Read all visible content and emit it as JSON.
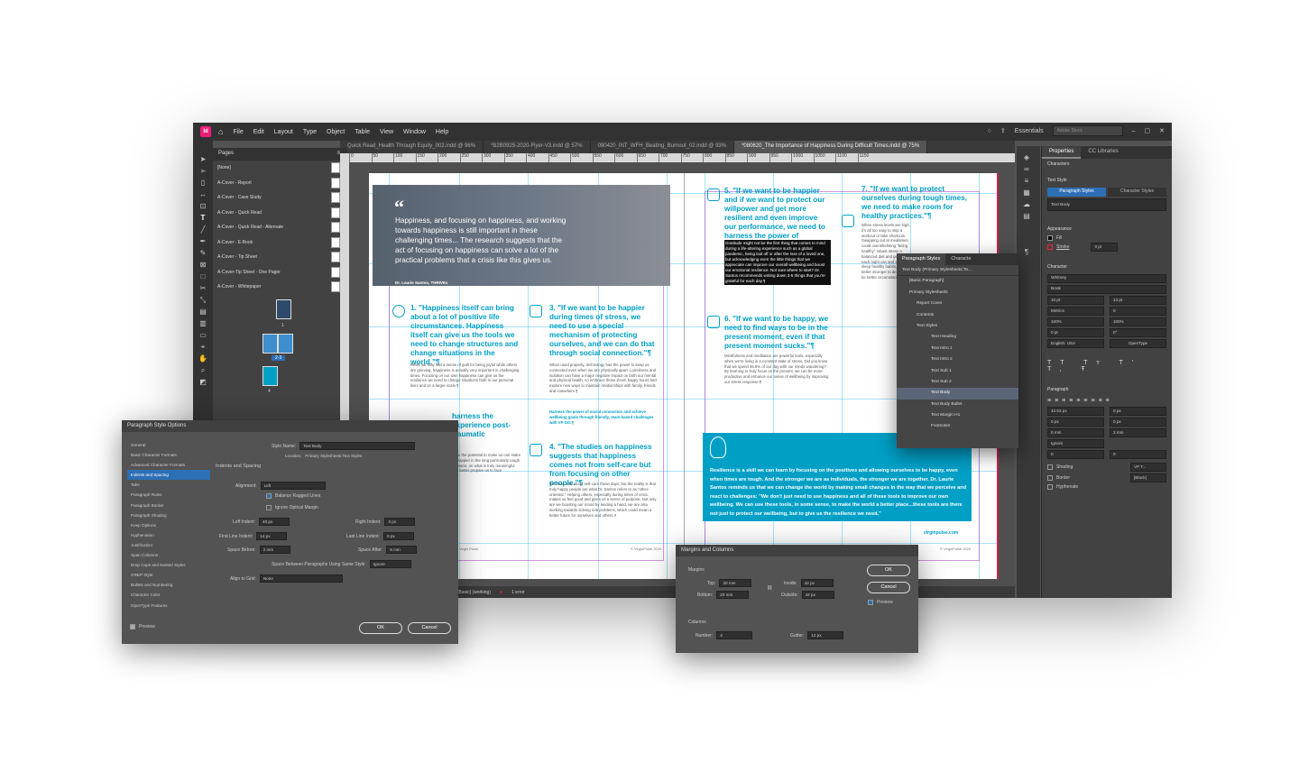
{
  "app": {
    "logo": "Id",
    "menu": [
      "File",
      "Edit",
      "Layout",
      "Type",
      "Object",
      "Table",
      "View",
      "Window",
      "Help"
    ],
    "workspace": "Essentials",
    "search_placeholder": "Adobe Stock",
    "tabs": [
      {
        "label": "Quick Read_Health Through Equity_002.indd @ 96%"
      },
      {
        "label": "*B2B0925-2020-Flyer-V3.indd @ 57%"
      },
      {
        "label": "090420_INT_WFH_Beating_Burnout_02.indd @ 93%"
      },
      {
        "label": "*080620_The Importance of Happiness During Difficult Times.indd @ 75%"
      }
    ]
  },
  "pages_panel": {
    "title": "Pages",
    "masters": [
      "[None]",
      "A-Cover - Report",
      "A-Cover - Case Study",
      "A-Cover - Quick Read",
      "A-Cover - Quick Read - Alternate",
      "A-Cover - E-Book",
      "A-Cover - Tip Sheet",
      "A-Cover-Tip Sheet - One Pager",
      "A-Cover - Whitepaper"
    ],
    "page_labels": [
      "1",
      "2-3",
      "4"
    ]
  },
  "ruler": [
    "0",
    "50",
    "100",
    "150",
    "200",
    "250",
    "300",
    "350",
    "400",
    "450",
    "500",
    "550",
    "600",
    "650",
    "700",
    "750",
    "800",
    "850",
    "900",
    "950",
    "1000",
    "1050",
    "1100",
    "1150"
  ],
  "document": {
    "hero_quote": "Happiness, and focusing on happiness, and working towards happiness is still important in these challenging times... The research suggests that the act of focusing on happiness can solve a lot of the practical problems that a crisis like this gives us.",
    "hero_credit": "Dr. Laurie Santos, THRIVEx",
    "tip1_title": "1. \"Happiness itself can bring about a lot of positive life circumstances. Happiness itself can give us the tools we need to change structures and change situations in the world.\"¶",
    "tip1_body": "While we may feel a sense of guilt for being joyful while others are grieving, happiness is actually very important in challenging times. Focusing on our own happiness can give us the resilience we need to change situations both in our personal lives and on a larger scale.¶",
    "tip2_title_partial": "harness the experience post-traumatic",
    "tip2_body_partial": "have the potential to make us can make us happier in the long particularly tough scenario, on what is truly meaningful and better prepare us to face",
    "tip3_title": "3. \"If we want to be happier during times of stress, we need to use a special mechanism of protecting ourselves, and we can do that through social connection.\"¶",
    "tip3_body": "When used properly, technology has the power to keep us connected even when we are physically apart. Loneliness and isolation can have a major negative impact on both our mental and physical health, so embrace those Zoom happy hours and explore new ways to maintain relationships with family, friends and coworkers.¶",
    "tip3_link": "Harness the power of social connection and achieve wellbeing goals through friendly, team-based challenges with VP GO.¶",
    "tip4_title": "4. \"The studies on happiness suggests that happiness comes not from self-care but from focusing on other people.\"¶",
    "tip4_body": "We hear a lot about self-care these days, but the reality is that truly happy people are what Dr. Santos refers to as \"other-oriented.\" Helping others, especially during times of crisis, makes us feel good and gives us a sense of purpose. Not only are we boosting our mood by lending a hand, we are also working towards solving real problems, which could mean a better future for ourselves and others.#",
    "tip5_title": "5. \"If we want to be happier and if we want to protect our willpower and get more resilient and even improve our performance, we need to harness the power of gratitude.\"¶",
    "tip5_selected": "Gratitude might not be the first thing that comes to mind during a life-altering experience such as a global pandemic, being laid off or after the loss of a loved one, but acknowledging even the little things that we appreciate can improve our overall wellbeing and boost our emotional resilience. Not sure where to start? Dr. Santos recommends writing down 3-5 things that you're grateful for each day.¶",
    "tip6_title": "6. \"If we want to be happy, we need to find ways to be in the present moment, even if that present moment sucks.\"¶",
    "tip6_body": "Mindfulness and meditation are powerful tools, especially when we're living in a constant state of stress. Did you know that we spend 46.9% of our day with our minds wandering? By learning to truly focus on the present, we can be more productive and enhance our sense of wellbeing by improving our stress response.¶",
    "tip7_title": "7. \"If we want to protect ourselves during tough times, we need to make room for healthy practices.\"¶",
    "tip7_body": "When stress levels are high, it's all too easy to skip a workout or take shortcuts. Swapping out at mealtimes could overwhelming \"being healthy\" robust stress a balanced diet and getting the each night can and improve sleep healthy habits, it, we are better stronger to deal and will be better circumstances",
    "resilience": "Resilience is a skill we can learn by focusing on the positives and allowing ourselves to be happy, even when times are tough. And the stronger we are as individuals, the stronger we are together. Dr. Laurie Santos reminds us that we can change the world by making small changes in the way that we perceive and react to challenges: \"We don't just need to use happiness and all of these tools to improve our own wellbeing. We can use these tools, in some sense, to make the world a better place...these tools are there not just to protect our wellbeing, but to give us the resilience we need.\"",
    "footer_url": "virginpulse.com",
    "footer_left": "Virgin Pulse",
    "footer_right": "© VirginPulse 2020"
  },
  "statusbar": {
    "style": "[Basic] (working)",
    "errors": "1 error"
  },
  "properties": {
    "tabs": [
      "Properties",
      "CC Libraries"
    ],
    "characters": "Characters",
    "text_style": "Text Style",
    "style_tabs": [
      "Paragraph Styles",
      "Character Styles"
    ],
    "current_style": "Text Body",
    "appearance": "Appearance",
    "fill": "Fill",
    "stroke": "Stroke",
    "stroke_weight": "0 pt",
    "character": "Character",
    "font": "Whitney",
    "font_style": "Book",
    "font_size": "10 pt",
    "leading": "13 pt",
    "kerning": "Metrics",
    "tracking": "0",
    "vscale": "100%",
    "hscale": "100%",
    "baseline": "0 pt",
    "skew": "0°",
    "language": "English: USA",
    "opentype": "OpenType",
    "paragraph": "Paragraph",
    "left_indent": "42.52 px",
    "right_indent": "0 px",
    "first_indent": "0 px",
    "last_indent": "0 px",
    "space_before": "0 mm",
    "space_after": "2 mm",
    "hyphenate_mode": "Ignore",
    "drop_cap_lines": "0",
    "drop_cap_chars": "0",
    "shading": "Shading",
    "shading_swatch": "VP T...",
    "border": "Border",
    "border_swatch": "[Black]",
    "hyphenate": "Hyphenate"
  },
  "paragraph_styles_panel": {
    "tabs": [
      "Paragraph Styles",
      "Characte"
    ],
    "current": "Text Body (Primary Stylesheets:Te...",
    "items": [
      {
        "label": "[Basic Paragraph]",
        "level": 0
      },
      {
        "label": "Primary Stylesheets",
        "level": 0
      },
      {
        "label": "Report Cover",
        "level": 1
      },
      {
        "label": "Contents",
        "level": 1
      },
      {
        "label": "Text Styles",
        "level": 1
      },
      {
        "label": "Text Heading",
        "level": 2
      },
      {
        "label": "Text Intro 1",
        "level": 2
      },
      {
        "label": "Text Intro 2",
        "level": 2
      },
      {
        "label": "Text Sub 1",
        "level": 2
      },
      {
        "label": "Text Sub 2",
        "level": 2
      },
      {
        "label": "Text Body",
        "level": 2,
        "selected": true
      },
      {
        "label": "Text Body Bullet",
        "level": 2
      },
      {
        "label": "Text Margin H1",
        "level": 2
      },
      {
        "label": "Footnotes",
        "level": 2
      }
    ]
  },
  "pso_dialog": {
    "title": "Paragraph Style Options",
    "categories": [
      "General",
      "Basic Character Formats",
      "Advanced Character Formats",
      "Indents and Spacing",
      "Tabs",
      "Paragraph Rules",
      "Paragraph Border",
      "Paragraph Shading",
      "Keep Options",
      "Hyphenation",
      "Justification",
      "Span Columns",
      "Drop Caps and Nested Styles",
      "GREP Style",
      "Bullets and Numbering",
      "Character Color",
      "OpenType Features"
    ],
    "selected_index": 3,
    "style_name_label": "Style Name:",
    "style_name": "Text Body",
    "location_label": "Location:",
    "location": "Primary Stylesheets:Text Styles",
    "section": "Indents and Spacing",
    "alignment_label": "Alignment:",
    "alignment": "Left",
    "balance_label": "Balance Ragged Lines",
    "optical_label": "Ignore Optical Margin",
    "left_indent_label": "Left Indent:",
    "left_indent": "40 px",
    "right_indent_label": "Right Indent:",
    "right_indent": "3 px",
    "first_indent_label": "First Line Indent:",
    "first_indent": "14 px",
    "last_indent_label": "Last Line Indent:",
    "last_indent": "0 px",
    "space_before_label": "Space Before:",
    "space_before": "2 mm",
    "space_after_label": "Space After:",
    "space_after": "8 mm",
    "same_style_label": "Space Between Paragraphs Using Same Style:",
    "same_style": "Ignore",
    "grid_label": "Align to Grid:",
    "grid": "None",
    "preview": "Preview",
    "ok": "OK",
    "cancel": "Cancel"
  },
  "mc_dialog": {
    "title": "Margins and Columns",
    "margins": "Margins",
    "top_label": "Top:",
    "top": "20 mm",
    "bottom_label": "Bottom:",
    "bottom": "20 mm",
    "inside_label": "Inside:",
    "inside": "42 px",
    "outside_label": "Outside:",
    "outside": "42 px",
    "columns": "Columns",
    "number_label": "Number:",
    "number": "4",
    "gutter_label": "Gutter:",
    "gutter": "12 px",
    "ok": "OK",
    "cancel": "Cancel",
    "preview": "Preview"
  }
}
